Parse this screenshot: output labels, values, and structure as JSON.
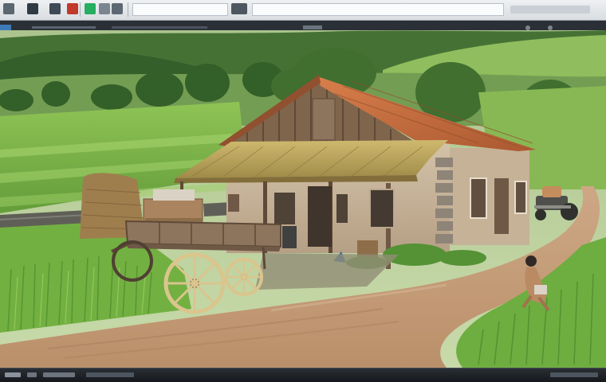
{
  "window": {
    "title": ""
  },
  "toolbar": {
    "icons": [
      "new-icon",
      "open-icon",
      "pen-icon",
      "color-icon",
      "brush-icon",
      "tool-icon",
      "arrow-icon",
      "zoom-icon",
      "settings-icon"
    ]
  },
  "image": {
    "subject": "rural-farmhouse-scene",
    "colors": {
      "sky": "#b9cfa0",
      "far_hills": "#6f9a4e",
      "fields": "#7fb24a",
      "road": "#c9a27a",
      "roof_tiles": "#c96a3a",
      "thatch": "#b89c52",
      "wall": "#c8b49a",
      "wood": "#6b5440"
    }
  }
}
